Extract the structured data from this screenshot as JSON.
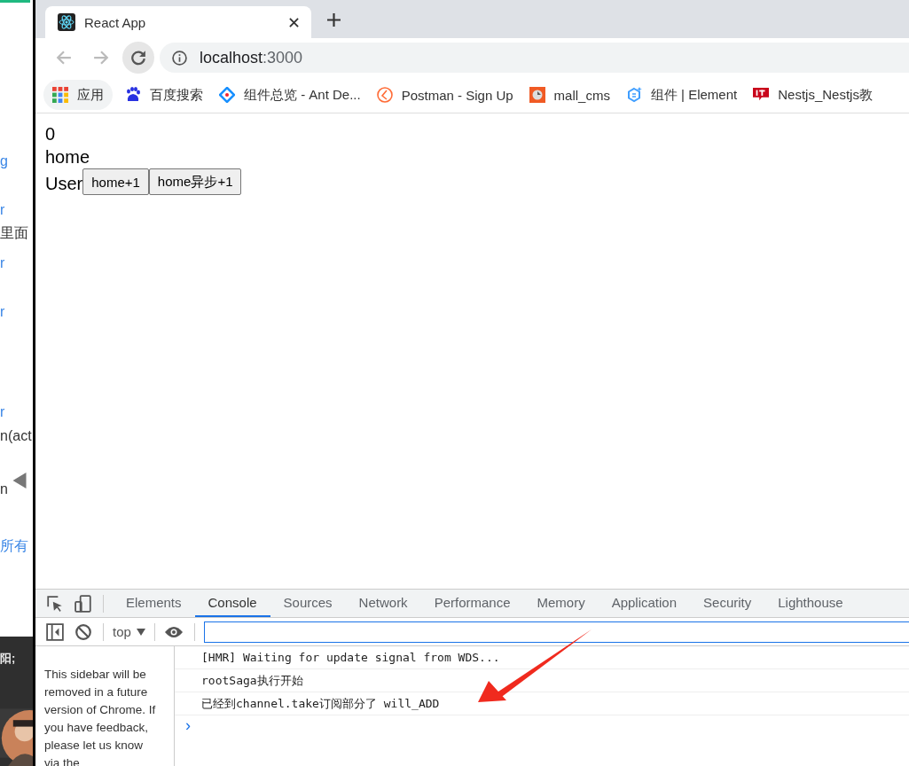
{
  "background_window": {
    "fragments": [
      {
        "text": "g",
        "kind": "link"
      },
      {
        "text": "r",
        "kind": "link"
      },
      {
        "text": "里面",
        "kind": "plain"
      },
      {
        "text": "r",
        "kind": "link"
      },
      {
        "text": "r",
        "kind": "link"
      },
      {
        "text": "r",
        "kind": "link"
      },
      {
        "text": "n(act",
        "kind": "plain"
      },
      {
        "text": "n",
        "kind": "plain"
      },
      {
        "text": "所有",
        "kind": "link"
      },
      {
        "text": "阳;",
        "kind": "dark"
      }
    ]
  },
  "browser": {
    "tab": {
      "title": "React App",
      "selected": true
    },
    "address": {
      "host": "localhost",
      "port": ":3000"
    },
    "bookmarks": [
      {
        "label": "应用",
        "kind": "apps"
      },
      {
        "label": "百度搜索",
        "kind": "paw"
      },
      {
        "label": "组件总览 - Ant De...",
        "kind": "diamond"
      },
      {
        "label": "Postman - Sign Up",
        "kind": "postman"
      },
      {
        "label": "mall_cms",
        "kind": "mall"
      },
      {
        "label": "组件 | Element",
        "kind": "hex"
      },
      {
        "label": "Nestjs_Nestjs教",
        "kind": "it"
      }
    ]
  },
  "page": {
    "count": "0",
    "lines": [
      "home",
      "User"
    ],
    "buttons": [
      "home+1",
      "home异步+1"
    ]
  },
  "devtools": {
    "tabs": [
      {
        "label": "Elements",
        "selected": false
      },
      {
        "label": "Console",
        "selected": true
      },
      {
        "label": "Sources",
        "selected": false
      },
      {
        "label": "Network",
        "selected": false
      },
      {
        "label": "Performance",
        "selected": false
      },
      {
        "label": "Memory",
        "selected": false
      },
      {
        "label": "Application",
        "selected": false
      },
      {
        "label": "Security",
        "selected": false
      },
      {
        "label": "Lighthouse",
        "selected": false
      }
    ],
    "context": "top",
    "sidebar_note": "This sidebar will be removed in a future version of Chrome. If you have feedback, please let us know via the",
    "messages": [
      "[HMR] Waiting for update signal from WDS...",
      "rootSaga执行开始",
      "已经到channel.take订阅部分了 will_ADD"
    ],
    "prompt": "›"
  }
}
